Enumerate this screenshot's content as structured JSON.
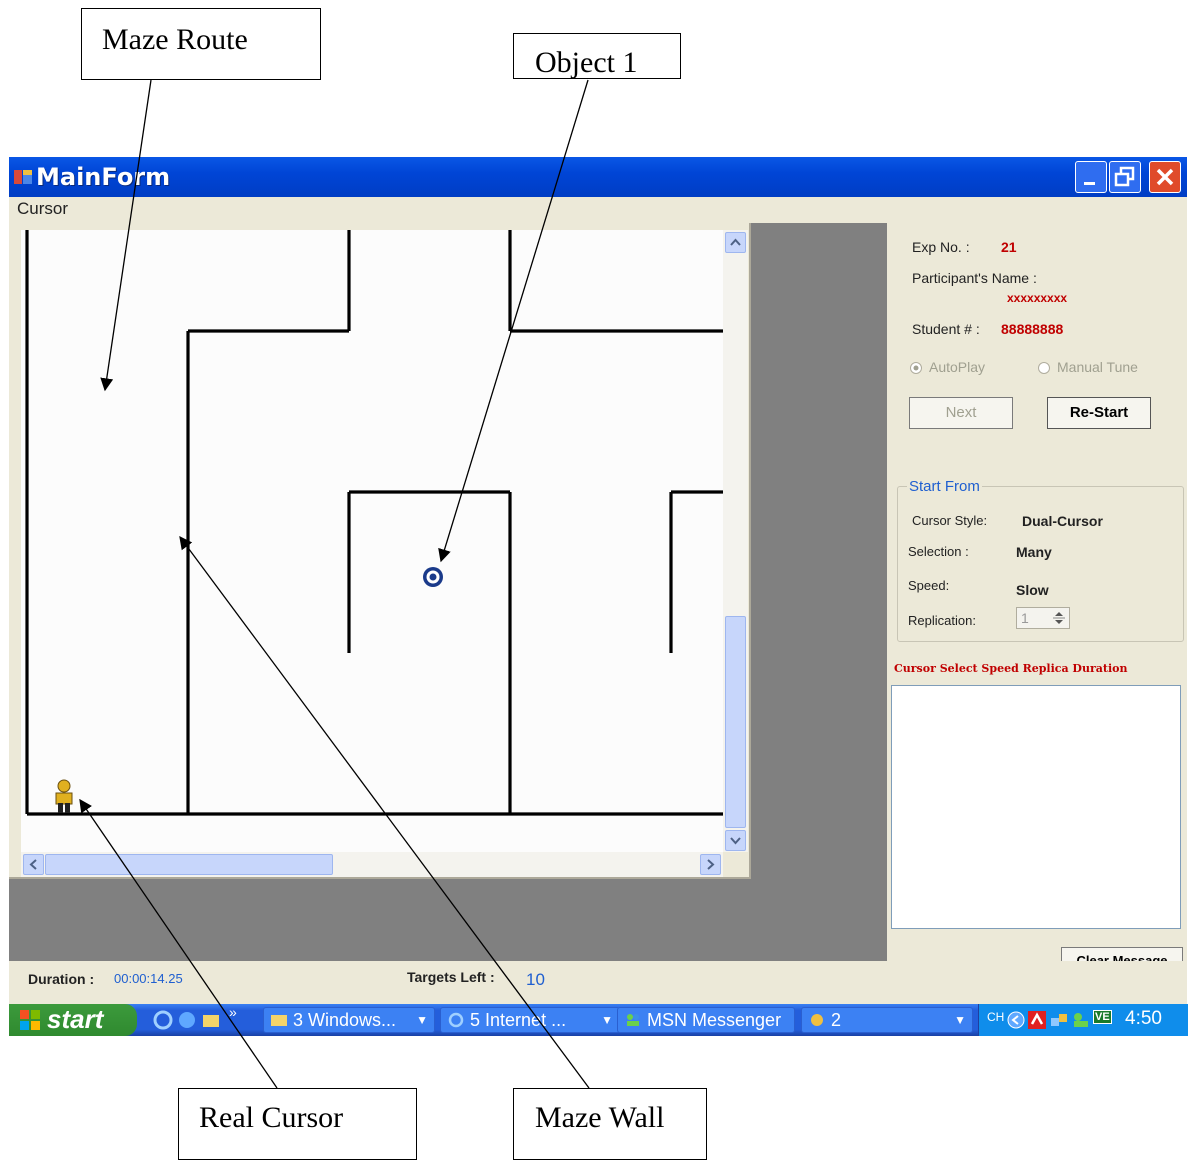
{
  "callouts": {
    "maze_route": "Maze Route",
    "object_1": "Object 1",
    "real_cursor": "Real Cursor",
    "maze_wall": "Maze Wall"
  },
  "window": {
    "title": "MainForm",
    "menu": [
      "Cursor"
    ]
  },
  "panel": {
    "exp_label": "Exp No. :",
    "exp_value": "21",
    "participant_label": "Participant's Name :",
    "participant_value": "xxxxxxxxx",
    "student_label": "Student # :",
    "student_value": "88888888",
    "radio_autoplay": "AutoPlay",
    "radio_manual": "Manual Tune",
    "next_button": "Next",
    "restart_button": "Re-Start",
    "group_title": "Start From",
    "cursor_style_label": "Cursor Style:",
    "cursor_style_value": "Dual-Cursor",
    "selection_label": "Selection :",
    "selection_value": "Many",
    "speed_label": "Speed:",
    "speed_value": "Slow",
    "replication_label": "Replication:",
    "replication_value": "1",
    "message_header": "Cursor Select Speed Replica Duration",
    "clear_button": "Clear Message"
  },
  "status": {
    "duration_label": "Duration :",
    "duration_value": "00:00:14.25",
    "targets_label": "Targets Left :",
    "targets_value": "10"
  },
  "taskbar": {
    "start_label": "start",
    "items": [
      "3 Windows...",
      "5 Internet ...",
      "MSN Messenger",
      "2"
    ],
    "lang": "CH",
    "tray_badge": "VE",
    "clock": "4:50"
  },
  "colors": {
    "titlebar": "#0045d6",
    "accent_red": "#c00000",
    "accent_blue": "#1f5fd0",
    "target": "#1a3a8a"
  }
}
